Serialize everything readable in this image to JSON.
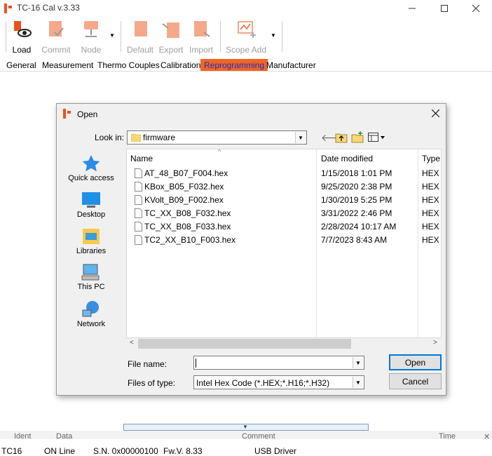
{
  "window": {
    "title": "TC-16 Cal v.3.33"
  },
  "toolbar": {
    "load": "Load",
    "commit": "Commit",
    "node": "Node",
    "default": "Default",
    "export": "Export",
    "import": "Import",
    "scope_add": "Scope Add"
  },
  "tabs": [
    "General",
    "Measurement",
    "Thermo Couples",
    "Calibration",
    "Reprogramming",
    "Manufacturer"
  ],
  "dialog": {
    "title": "Open",
    "look_in_label": "Look in:",
    "look_in_value": "firmware",
    "places": [
      "Quick access",
      "Desktop",
      "Libraries",
      "This PC",
      "Network"
    ],
    "columns": {
      "name": "Name",
      "date": "Date modified",
      "type": "Type"
    },
    "files": [
      {
        "name": "AT_48_B07_F004.hex",
        "date": "1/15/2018 1:01 PM",
        "type": "HEX F"
      },
      {
        "name": "KBox_B05_F032.hex",
        "date": "9/25/2020 2:38 PM",
        "type": "HEX F"
      },
      {
        "name": "KVolt_B09_F002.hex",
        "date": "1/30/2019 5:25 PM",
        "type": "HEX F"
      },
      {
        "name": "TC_XX_B08_F032.hex",
        "date": "3/31/2022 2:46 PM",
        "type": "HEX F"
      },
      {
        "name": "TC_XX_B08_F033.hex",
        "date": "2/28/2024 10:17 AM",
        "type": "HEX F"
      },
      {
        "name": "TC2_XX_B10_F003.hex",
        "date": "7/7/2023 8:43 AM",
        "type": "HEX F"
      }
    ],
    "file_name_label": "File name:",
    "file_name_value": "",
    "file_type_label": "Files of type:",
    "file_type_value": "Intel Hex Code (*.HEX;*.H16;*.H32)",
    "open_label": "Open",
    "cancel_label": "Cancel"
  },
  "log": {
    "columns": [
      "Ident",
      "Data",
      "Comment",
      "Time"
    ]
  },
  "status": {
    "device": "TC16",
    "state": "ON Line",
    "serial": "S.N. 0x00000100",
    "firmware": "Fw.V. 8.33",
    "driver": "USB Driver"
  },
  "colors": {
    "accent": "#f26522",
    "tab_active_text": "#1a2fd0",
    "selection_blue": "#0078d7"
  }
}
